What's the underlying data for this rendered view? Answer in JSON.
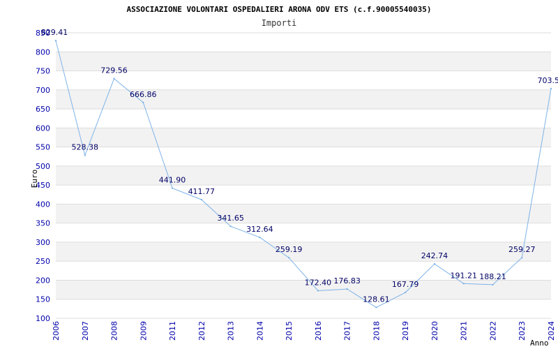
{
  "chart_data": {
    "type": "line",
    "title": "ASSOCIAZIONE VOLONTARI OSPEDALIERI ARONA ODV ETS (c.f.90005540035)",
    "subtitle": "Importi",
    "xlabel": "Anno",
    "ylabel": "Euro",
    "ylim": [
      100,
      850
    ],
    "yticks": [
      100,
      150,
      200,
      250,
      300,
      350,
      400,
      450,
      500,
      550,
      600,
      650,
      700,
      750,
      800,
      850
    ],
    "grid": true,
    "x": [
      "2006",
      "2007",
      "2008",
      "2009",
      "2011",
      "2012",
      "2013",
      "2014",
      "2015",
      "2016",
      "2017",
      "2018",
      "2019",
      "2020",
      "2021",
      "2022",
      "2023",
      "2024"
    ],
    "values": [
      829.41,
      528.38,
      729.56,
      666.86,
      441.9,
      411.77,
      341.65,
      312.64,
      259.19,
      172.4,
      176.83,
      128.61,
      167.79,
      242.74,
      191.21,
      188.21,
      259.27,
      703.5
    ],
    "labels": [
      "829.41",
      "528.38",
      "729.56",
      "666.86",
      "441.90",
      "411.77",
      "341.65",
      "312.64",
      "259.19",
      "172.40",
      "176.83",
      "128.61",
      "167.79",
      "242.74",
      "191.21",
      "188.21",
      "259.27",
      "703.5"
    ],
    "colors": {
      "line": "#7eb3e8",
      "band": "#f2f2f2",
      "gridline": "#dddddd",
      "tick_text": "#0000aa",
      "data_text": "#000066"
    }
  }
}
